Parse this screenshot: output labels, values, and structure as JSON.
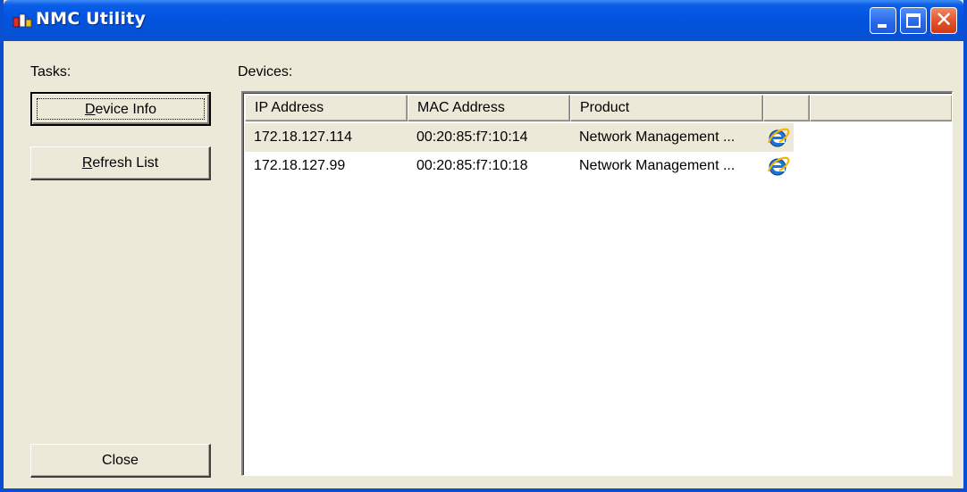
{
  "window": {
    "title": "NMC Utility",
    "icon": "nmc-app-icon",
    "controls": {
      "minimize": "minimize-icon",
      "maximize": "maximize-icon",
      "close": "close-icon"
    },
    "accent_color": "#0a4fd1",
    "close_color": "#e0512b",
    "face_color": "#ece9d8"
  },
  "tasks": {
    "label": "Tasks:",
    "buttons": {
      "device_info": {
        "accel": "D",
        "rest": "evice Info"
      },
      "refresh_list": {
        "accel": "R",
        "rest": "efresh List"
      },
      "close": "Close"
    }
  },
  "devices": {
    "label": "Devices:",
    "columns": [
      "IP Address",
      "MAC Address",
      "Product",
      "",
      ""
    ],
    "rows": [
      {
        "ip": "172.18.127.114",
        "mac": "00:20:85:f7:10:14",
        "product": "Network Management ...",
        "icon": "internet-explorer-icon",
        "selected": true
      },
      {
        "ip": "172.18.127.99",
        "mac": "00:20:85:f7:10:18",
        "product": "Network Management ...",
        "icon": "internet-explorer-icon",
        "selected": false
      }
    ]
  }
}
